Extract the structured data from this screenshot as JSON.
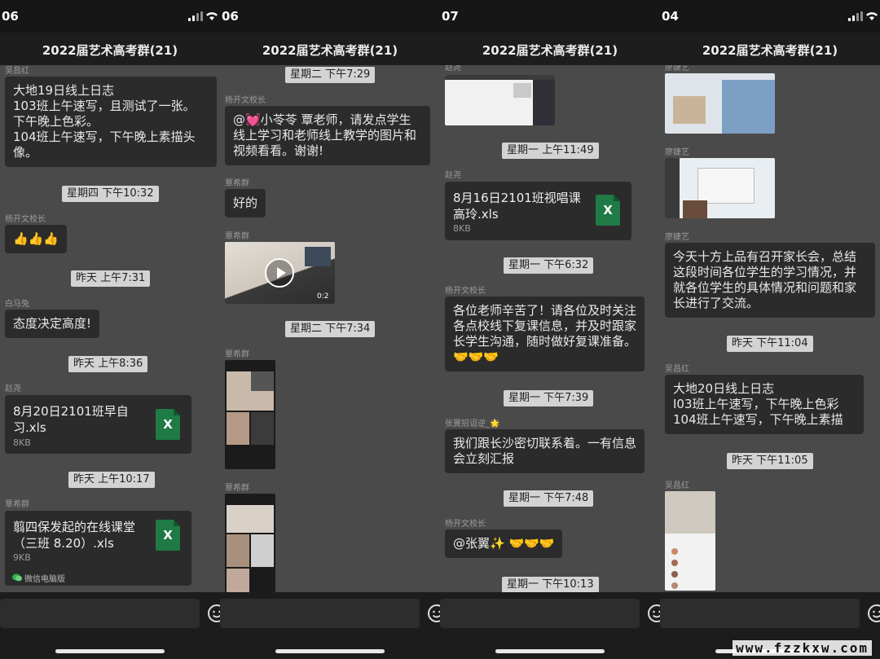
{
  "chat_title": "2022届艺术高考群(21)",
  "panels": [
    {
      "status_time": "06",
      "items": {
        "m1_sender": "吴昌红",
        "m1_text": "大地19日线上日志\n103班上午速写，且测试了一张。\n下午晚上色彩。\n104班上午速写，下午晚上素描头像。",
        "t1": "星期四 下午10:32",
        "m2_sender": "杨开文校长",
        "m2_text": "👍👍👍",
        "t2": "昨天 上午7:31",
        "m3_sender": "白马兔",
        "m3_text": "态度决定高度!",
        "t3": "昨天 上午8:36",
        "f1_sender": "赵尧",
        "f1_name": "8月20日2101班早自习.xls",
        "f1_size": "8KB",
        "t4": "昨天 上午10:17",
        "f2_sender": "覃希群",
        "f2_name": "翦四保发起的在线课堂（三班 8.20）.xls",
        "f2_size": "9KB",
        "f2_source": "微信电脑版"
      }
    },
    {
      "status_time": "06",
      "items": {
        "t1": "星期二 下午7:29",
        "m1_sender": "杨开文校长",
        "m1_text": "@💓小苓苓 覃老师，请发点学生线上学习和老师线上教学的图片和视频看看。谢谢!",
        "m2_sender": "覃希群",
        "m2_text": "好的",
        "v_sender": "覃希群",
        "v_duration": "0:2",
        "t2": "星期二 下午7:34",
        "i1_sender": "覃希群",
        "i2_sender": "覃希群"
      }
    },
    {
      "status_time": "07",
      "items": {
        "i0_sender": "赵尧",
        "t1": "星期一 上午11:49",
        "f1_sender": "赵尧",
        "f1_name": "8月16日2101班视唱课高玲.xls",
        "f1_size": "8KB",
        "t2": "星期一 下午6:32",
        "m1_sender": "杨开文校长",
        "m1_text": "各位老师辛苦了！请各位及时关注各点校线下复课信息，并及时跟家长学生沟通，随时做好复课准备。🤝🤝🤝",
        "t3": "星期一 下午7:39",
        "m2_sender": "张翼招诅逆_🌟",
        "m2_text": "我们跟长沙密切联系着。一有信息会立刻汇报",
        "t4": "星期一 下午7:48",
        "m3_sender": "杨开文校长",
        "m3_text": "@张翼✨ 🤝🤝🤝",
        "t5": "星期一 下午10:13"
      }
    },
    {
      "status_time": "04",
      "items": {
        "i1_sender": "廖婕艺",
        "i2_sender": "廖婕艺",
        "m1_sender": "廖婕艺",
        "m1_text": "今天十方上品有召开家长会，总结这段时间各位学生的学习情况，并就各位学生的具体情况和问题和家长进行了交流。",
        "t1": "昨天 下午11:04",
        "m2_sender": "吴昌红",
        "m2_text": "大地20日线上日志\nI03班上午速写，下午晚上色彩\n104班上午速写，下午晚上素描",
        "t2": "昨天 下午11:05",
        "i3_sender": "吴昌红"
      }
    }
  ],
  "icons": {
    "xls": "X"
  },
  "watermark": "www.fzzkxw.com"
}
